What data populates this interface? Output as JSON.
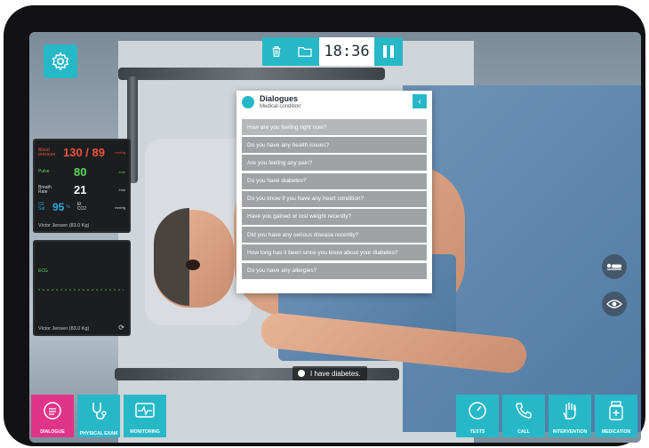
{
  "toolbar": {
    "timer": "18:36"
  },
  "vitals": {
    "bp_label": "Blood pressure",
    "bp_value": "130 / 89",
    "bp_unit": "mmHg",
    "pulse_label": "Pulse",
    "pulse_value": "80",
    "pulse_unit": "/min",
    "breath_label": "Breath Rate",
    "breath_value": "21",
    "breath_unit": "/min",
    "o2_label": "O2 Sat",
    "o2_value": "95",
    "o2_unit": "%",
    "co2_label": "Et CO2",
    "co2_unit": "mmHg",
    "patient": "Victor Jensen (83.0 Kg)"
  },
  "ecg": {
    "label": "ECG",
    "patient": "Victor Jensen (83.0 Kg)"
  },
  "dialog": {
    "title": "Dialogues",
    "subtitle": "Medical condition",
    "questions": [
      "How are you feeling right now?",
      "Do you have any health issues?",
      "Are you feeling any pain?",
      "Do you have diabetes?",
      "Do you know if you have any heart condition?",
      "Have you gained or lost weight recently?",
      "Did you have any serious disease recently?",
      "How long has it been since you know about your diabetes?",
      "Do you have any allergies?"
    ]
  },
  "caption": "I have diabetes.",
  "tabs": {
    "dialogue": "DIALOGUE",
    "physical": "PHYSICAL EXAM",
    "monitoring": "MONITORING",
    "tests": "TESTS",
    "call": "CALL",
    "intervention": "INTERVENTION",
    "medication": "MEDICATION"
  },
  "colors": {
    "accent": "#27b8c8",
    "active": "#e0348a",
    "bp": "#e8553a",
    "pulse": "#5fd35f",
    "o2": "#29a8e0"
  }
}
